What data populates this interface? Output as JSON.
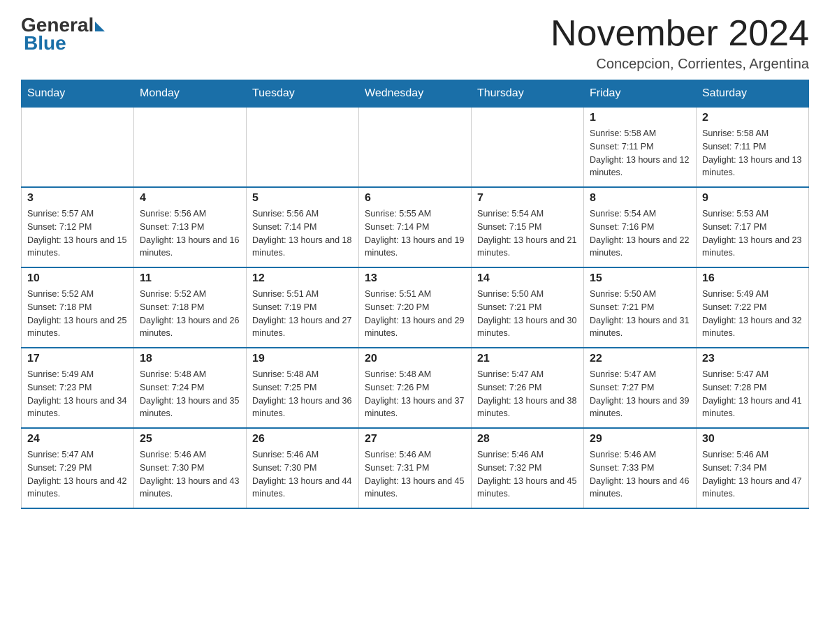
{
  "logo": {
    "general": "General",
    "blue": "Blue"
  },
  "title": "November 2024",
  "subtitle": "Concepcion, Corrientes, Argentina",
  "weekdays": [
    "Sunday",
    "Monday",
    "Tuesday",
    "Wednesday",
    "Thursday",
    "Friday",
    "Saturday"
  ],
  "weeks": [
    [
      {
        "day": "",
        "sunrise": "",
        "sunset": "",
        "daylight": ""
      },
      {
        "day": "",
        "sunrise": "",
        "sunset": "",
        "daylight": ""
      },
      {
        "day": "",
        "sunrise": "",
        "sunset": "",
        "daylight": ""
      },
      {
        "day": "",
        "sunrise": "",
        "sunset": "",
        "daylight": ""
      },
      {
        "day": "",
        "sunrise": "",
        "sunset": "",
        "daylight": ""
      },
      {
        "day": "1",
        "sunrise": "Sunrise: 5:58 AM",
        "sunset": "Sunset: 7:11 PM",
        "daylight": "Daylight: 13 hours and 12 minutes."
      },
      {
        "day": "2",
        "sunrise": "Sunrise: 5:58 AM",
        "sunset": "Sunset: 7:11 PM",
        "daylight": "Daylight: 13 hours and 13 minutes."
      }
    ],
    [
      {
        "day": "3",
        "sunrise": "Sunrise: 5:57 AM",
        "sunset": "Sunset: 7:12 PM",
        "daylight": "Daylight: 13 hours and 15 minutes."
      },
      {
        "day": "4",
        "sunrise": "Sunrise: 5:56 AM",
        "sunset": "Sunset: 7:13 PM",
        "daylight": "Daylight: 13 hours and 16 minutes."
      },
      {
        "day": "5",
        "sunrise": "Sunrise: 5:56 AM",
        "sunset": "Sunset: 7:14 PM",
        "daylight": "Daylight: 13 hours and 18 minutes."
      },
      {
        "day": "6",
        "sunrise": "Sunrise: 5:55 AM",
        "sunset": "Sunset: 7:14 PM",
        "daylight": "Daylight: 13 hours and 19 minutes."
      },
      {
        "day": "7",
        "sunrise": "Sunrise: 5:54 AM",
        "sunset": "Sunset: 7:15 PM",
        "daylight": "Daylight: 13 hours and 21 minutes."
      },
      {
        "day": "8",
        "sunrise": "Sunrise: 5:54 AM",
        "sunset": "Sunset: 7:16 PM",
        "daylight": "Daylight: 13 hours and 22 minutes."
      },
      {
        "day": "9",
        "sunrise": "Sunrise: 5:53 AM",
        "sunset": "Sunset: 7:17 PM",
        "daylight": "Daylight: 13 hours and 23 minutes."
      }
    ],
    [
      {
        "day": "10",
        "sunrise": "Sunrise: 5:52 AM",
        "sunset": "Sunset: 7:18 PM",
        "daylight": "Daylight: 13 hours and 25 minutes."
      },
      {
        "day": "11",
        "sunrise": "Sunrise: 5:52 AM",
        "sunset": "Sunset: 7:18 PM",
        "daylight": "Daylight: 13 hours and 26 minutes."
      },
      {
        "day": "12",
        "sunrise": "Sunrise: 5:51 AM",
        "sunset": "Sunset: 7:19 PM",
        "daylight": "Daylight: 13 hours and 27 minutes."
      },
      {
        "day": "13",
        "sunrise": "Sunrise: 5:51 AM",
        "sunset": "Sunset: 7:20 PM",
        "daylight": "Daylight: 13 hours and 29 minutes."
      },
      {
        "day": "14",
        "sunrise": "Sunrise: 5:50 AM",
        "sunset": "Sunset: 7:21 PM",
        "daylight": "Daylight: 13 hours and 30 minutes."
      },
      {
        "day": "15",
        "sunrise": "Sunrise: 5:50 AM",
        "sunset": "Sunset: 7:21 PM",
        "daylight": "Daylight: 13 hours and 31 minutes."
      },
      {
        "day": "16",
        "sunrise": "Sunrise: 5:49 AM",
        "sunset": "Sunset: 7:22 PM",
        "daylight": "Daylight: 13 hours and 32 minutes."
      }
    ],
    [
      {
        "day": "17",
        "sunrise": "Sunrise: 5:49 AM",
        "sunset": "Sunset: 7:23 PM",
        "daylight": "Daylight: 13 hours and 34 minutes."
      },
      {
        "day": "18",
        "sunrise": "Sunrise: 5:48 AM",
        "sunset": "Sunset: 7:24 PM",
        "daylight": "Daylight: 13 hours and 35 minutes."
      },
      {
        "day": "19",
        "sunrise": "Sunrise: 5:48 AM",
        "sunset": "Sunset: 7:25 PM",
        "daylight": "Daylight: 13 hours and 36 minutes."
      },
      {
        "day": "20",
        "sunrise": "Sunrise: 5:48 AM",
        "sunset": "Sunset: 7:26 PM",
        "daylight": "Daylight: 13 hours and 37 minutes."
      },
      {
        "day": "21",
        "sunrise": "Sunrise: 5:47 AM",
        "sunset": "Sunset: 7:26 PM",
        "daylight": "Daylight: 13 hours and 38 minutes."
      },
      {
        "day": "22",
        "sunrise": "Sunrise: 5:47 AM",
        "sunset": "Sunset: 7:27 PM",
        "daylight": "Daylight: 13 hours and 39 minutes."
      },
      {
        "day": "23",
        "sunrise": "Sunrise: 5:47 AM",
        "sunset": "Sunset: 7:28 PM",
        "daylight": "Daylight: 13 hours and 41 minutes."
      }
    ],
    [
      {
        "day": "24",
        "sunrise": "Sunrise: 5:47 AM",
        "sunset": "Sunset: 7:29 PM",
        "daylight": "Daylight: 13 hours and 42 minutes."
      },
      {
        "day": "25",
        "sunrise": "Sunrise: 5:46 AM",
        "sunset": "Sunset: 7:30 PM",
        "daylight": "Daylight: 13 hours and 43 minutes."
      },
      {
        "day": "26",
        "sunrise": "Sunrise: 5:46 AM",
        "sunset": "Sunset: 7:30 PM",
        "daylight": "Daylight: 13 hours and 44 minutes."
      },
      {
        "day": "27",
        "sunrise": "Sunrise: 5:46 AM",
        "sunset": "Sunset: 7:31 PM",
        "daylight": "Daylight: 13 hours and 45 minutes."
      },
      {
        "day": "28",
        "sunrise": "Sunrise: 5:46 AM",
        "sunset": "Sunset: 7:32 PM",
        "daylight": "Daylight: 13 hours and 45 minutes."
      },
      {
        "day": "29",
        "sunrise": "Sunrise: 5:46 AM",
        "sunset": "Sunset: 7:33 PM",
        "daylight": "Daylight: 13 hours and 46 minutes."
      },
      {
        "day": "30",
        "sunrise": "Sunrise: 5:46 AM",
        "sunset": "Sunset: 7:34 PM",
        "daylight": "Daylight: 13 hours and 47 minutes."
      }
    ]
  ]
}
